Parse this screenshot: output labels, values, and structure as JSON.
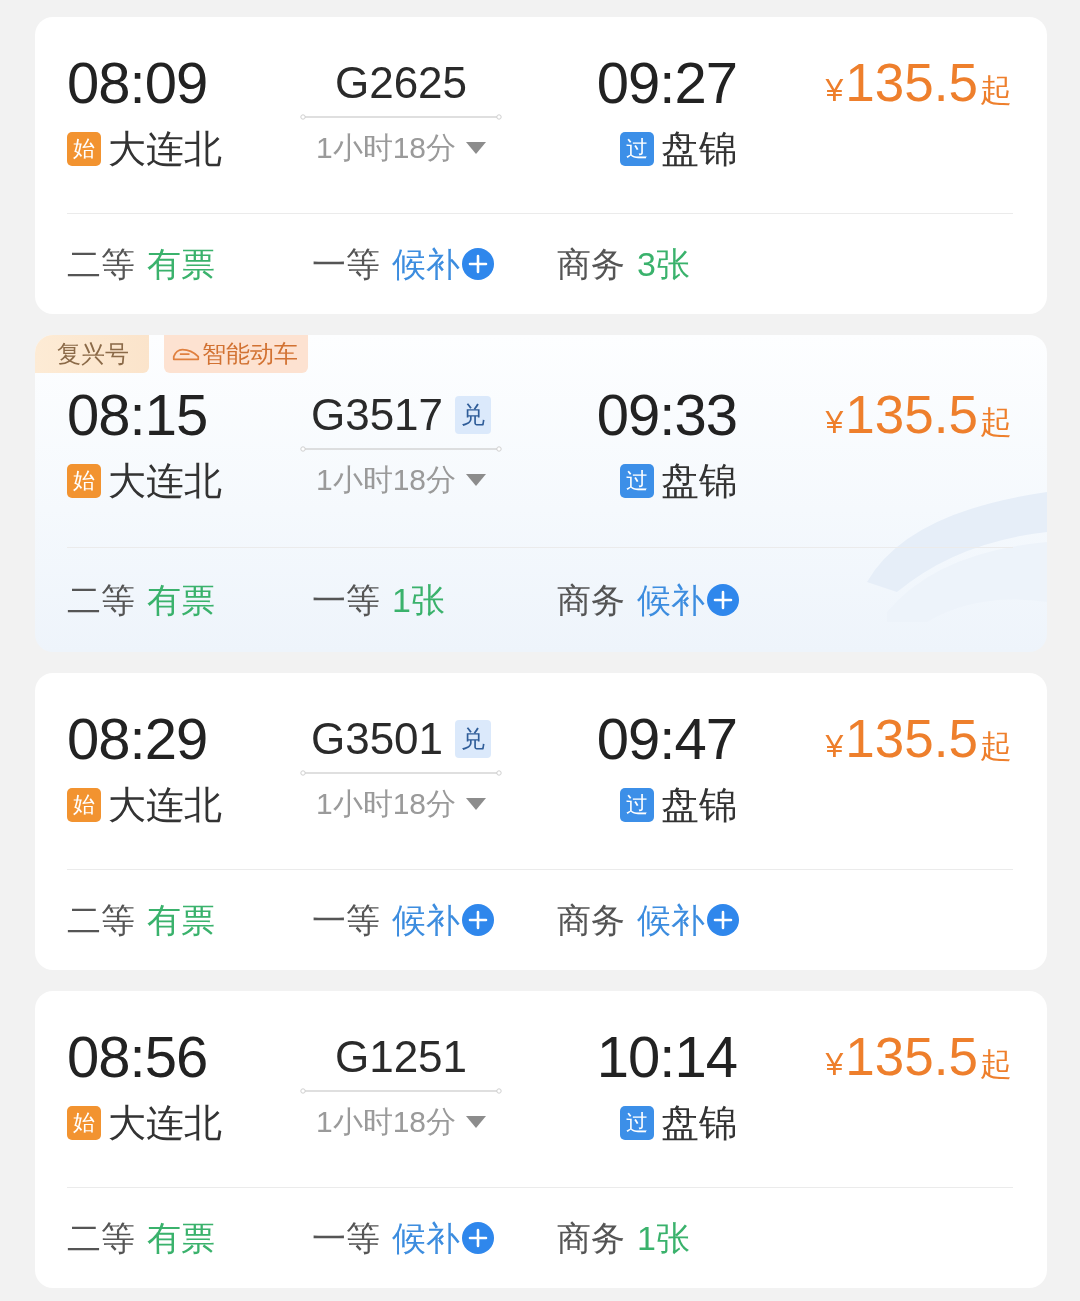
{
  "trains": [
    {
      "depart": {
        "time": "08:09",
        "kind": "origin",
        "badge": "始",
        "station": "大连北"
      },
      "train_no": "G2625",
      "duration": "1小时18分",
      "arrive": {
        "time": "09:27",
        "kind": "pass",
        "badge": "过",
        "station": "盘锦"
      },
      "price": {
        "currency": "¥",
        "amount": "135.5",
        "suffix": "起"
      },
      "seats": [
        {
          "class": "二等",
          "status": "有票",
          "kind": "available"
        },
        {
          "class": "一等",
          "status": "候补",
          "kind": "waitlist"
        },
        {
          "class": "商务",
          "status": "3张",
          "kind": "available"
        }
      ]
    },
    {
      "tags": [
        {
          "label": "复兴号",
          "kind": "plain"
        },
        {
          "label": "智能动车",
          "kind": "train"
        }
      ],
      "depart": {
        "time": "08:15",
        "kind": "origin",
        "badge": "始",
        "station": "大连北"
      },
      "train_no": "G3517",
      "badge": "兑",
      "duration": "1小时18分",
      "arrive": {
        "time": "09:33",
        "kind": "pass",
        "badge": "过",
        "station": "盘锦"
      },
      "price": {
        "currency": "¥",
        "amount": "135.5",
        "suffix": "起"
      },
      "seats": [
        {
          "class": "二等",
          "status": "有票",
          "kind": "available"
        },
        {
          "class": "一等",
          "status": "1张",
          "kind": "available"
        },
        {
          "class": "商务",
          "status": "候补",
          "kind": "waitlist"
        }
      ]
    },
    {
      "depart": {
        "time": "08:29",
        "kind": "origin",
        "badge": "始",
        "station": "大连北"
      },
      "train_no": "G3501",
      "badge": "兑",
      "duration": "1小时18分",
      "arrive": {
        "time": "09:47",
        "kind": "pass",
        "badge": "过",
        "station": "盘锦"
      },
      "price": {
        "currency": "¥",
        "amount": "135.5",
        "suffix": "起"
      },
      "seats": [
        {
          "class": "二等",
          "status": "有票",
          "kind": "available"
        },
        {
          "class": "一等",
          "status": "候补",
          "kind": "waitlist"
        },
        {
          "class": "商务",
          "status": "候补",
          "kind": "waitlist"
        }
      ]
    },
    {
      "depart": {
        "time": "08:56",
        "kind": "origin",
        "badge": "始",
        "station": "大连北"
      },
      "train_no": "G1251",
      "duration": "1小时18分",
      "arrive": {
        "time": "10:14",
        "kind": "pass",
        "badge": "过",
        "station": "盘锦"
      },
      "price": {
        "currency": "¥",
        "amount": "135.5",
        "suffix": "起"
      },
      "seats": [
        {
          "class": "二等",
          "status": "有票",
          "kind": "available"
        },
        {
          "class": "一等",
          "status": "候补",
          "kind": "waitlist"
        },
        {
          "class": "商务",
          "status": "1张",
          "kind": "available"
        }
      ]
    }
  ]
}
